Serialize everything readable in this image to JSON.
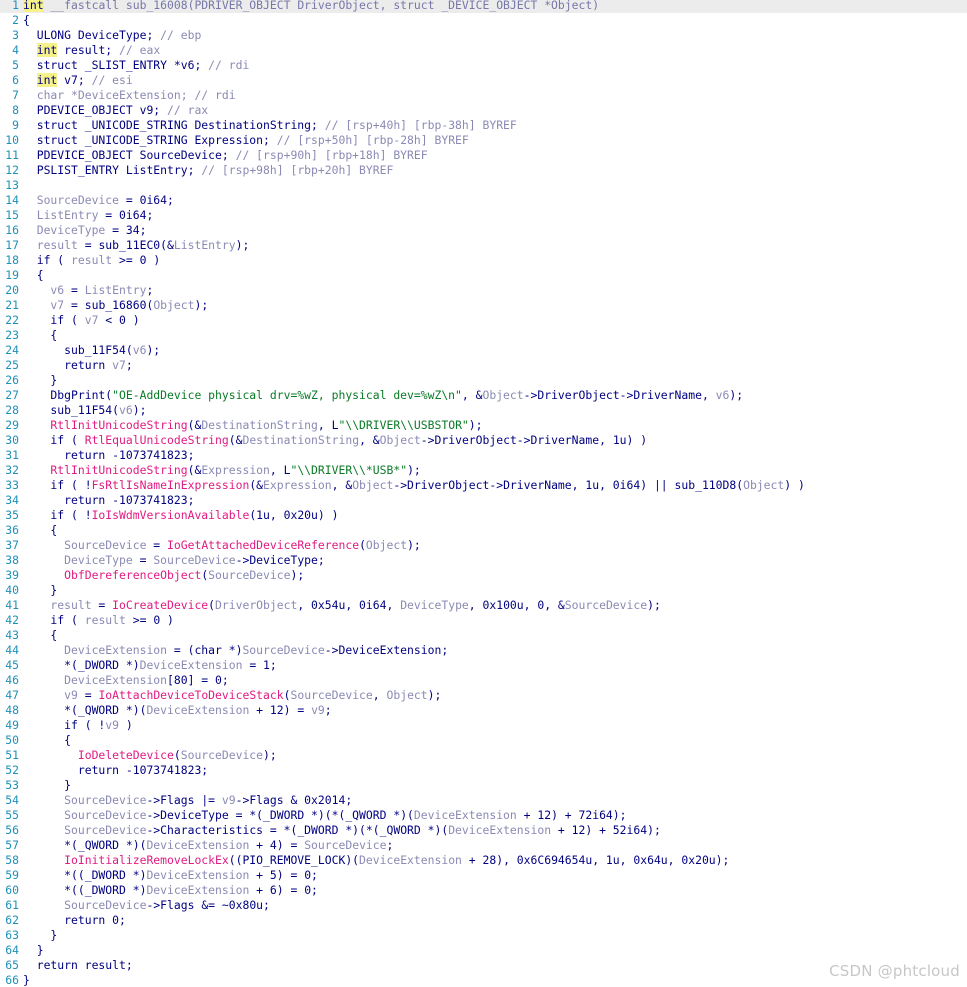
{
  "watermark": "CSDN @phtcloud",
  "colors": {
    "keyword": "#000080",
    "variable": "#8a8ab4",
    "function": "#e01b83",
    "string": "#0a7a26",
    "line_number": "#1e90b8",
    "highlight": "#f5f28a"
  },
  "lines": [
    {
      "n": "1",
      "t": [
        {
          "s": "hl",
          "v": "int"
        },
        {
          "s": "dim",
          "v": " __fastcall sub_16008(PDRIVER_OBJECT DriverObject, struct _DEVICE_OBJECT *Object)"
        }
      ]
    },
    {
      "n": "2",
      "t": [
        {
          "s": "txt",
          "v": "{"
        }
      ]
    },
    {
      "n": "3",
      "t": [
        {
          "s": "txt",
          "v": "  ULONG DeviceType; "
        },
        {
          "s": "cm",
          "v": "// ebp"
        }
      ]
    },
    {
      "n": "4",
      "t": [
        {
          "s": "txt",
          "v": "  "
        },
        {
          "s": "hl",
          "v": "int"
        },
        {
          "s": "txt",
          "v": " result; "
        },
        {
          "s": "cm",
          "v": "// eax"
        }
      ]
    },
    {
      "n": "5",
      "t": [
        {
          "s": "txt",
          "v": "  struct _SLIST_ENTRY *v6; "
        },
        {
          "s": "cm",
          "v": "// rdi"
        }
      ]
    },
    {
      "n": "6",
      "t": [
        {
          "s": "txt",
          "v": "  "
        },
        {
          "s": "hl",
          "v": "int"
        },
        {
          "s": "txt",
          "v": " v7; "
        },
        {
          "s": "cm",
          "v": "// esi"
        }
      ]
    },
    {
      "n": "7",
      "t": [
        {
          "s": "var",
          "v": "  char *DeviceExtension; "
        },
        {
          "s": "cm",
          "v": "// rdi"
        }
      ]
    },
    {
      "n": "8",
      "t": [
        {
          "s": "txt",
          "v": "  PDEVICE_OBJECT v9; "
        },
        {
          "s": "cm",
          "v": "// rax"
        }
      ]
    },
    {
      "n": "9",
      "t": [
        {
          "s": "txt",
          "v": "  struct _UNICODE_STRING DestinationString; "
        },
        {
          "s": "cm",
          "v": "// [rsp+40h] [rbp-38h] BYREF"
        }
      ]
    },
    {
      "n": "10",
      "t": [
        {
          "s": "txt",
          "v": "  struct _UNICODE_STRING Expression; "
        },
        {
          "s": "cm",
          "v": "// [rsp+50h] [rbp-28h] BYREF"
        }
      ]
    },
    {
      "n": "11",
      "t": [
        {
          "s": "txt",
          "v": "  PDEVICE_OBJECT SourceDevice; "
        },
        {
          "s": "cm",
          "v": "// [rsp+90h] [rbp+18h] BYREF"
        }
      ]
    },
    {
      "n": "12",
      "t": [
        {
          "s": "txt",
          "v": "  PSLIST_ENTRY ListEntry; "
        },
        {
          "s": "cm",
          "v": "// [rsp+98h] [rbp+20h] BYREF"
        }
      ]
    },
    {
      "n": "13",
      "t": []
    },
    {
      "n": "14",
      "t": [
        {
          "s": "var",
          "v": "  SourceDevice"
        },
        {
          "s": "txt",
          "v": " = 0i64;"
        }
      ]
    },
    {
      "n": "15",
      "t": [
        {
          "s": "var",
          "v": "  ListEntry"
        },
        {
          "s": "txt",
          "v": " = 0i64;"
        }
      ]
    },
    {
      "n": "16",
      "t": [
        {
          "s": "var",
          "v": "  DeviceType"
        },
        {
          "s": "txt",
          "v": " = 34;"
        }
      ]
    },
    {
      "n": "17",
      "t": [
        {
          "s": "var",
          "v": "  result"
        },
        {
          "s": "txt",
          "v": " = sub_11EC0(&"
        },
        {
          "s": "var",
          "v": "ListEntry"
        },
        {
          "s": "txt",
          "v": ");"
        }
      ]
    },
    {
      "n": "18",
      "t": [
        {
          "s": "txt",
          "v": "  if ( "
        },
        {
          "s": "var",
          "v": "result"
        },
        {
          "s": "txt",
          "v": " >= 0 )"
        }
      ]
    },
    {
      "n": "19",
      "t": [
        {
          "s": "txt",
          "v": "  {"
        }
      ]
    },
    {
      "n": "20",
      "t": [
        {
          "s": "var",
          "v": "    v6"
        },
        {
          "s": "txt",
          "v": " = "
        },
        {
          "s": "var",
          "v": "ListEntry"
        },
        {
          "s": "txt",
          "v": ";"
        }
      ]
    },
    {
      "n": "21",
      "t": [
        {
          "s": "var",
          "v": "    v7"
        },
        {
          "s": "txt",
          "v": " = sub_16860("
        },
        {
          "s": "var",
          "v": "Object"
        },
        {
          "s": "txt",
          "v": ");"
        }
      ]
    },
    {
      "n": "22",
      "t": [
        {
          "s": "txt",
          "v": "    if ( "
        },
        {
          "s": "var",
          "v": "v7"
        },
        {
          "s": "txt",
          "v": " < 0 )"
        }
      ]
    },
    {
      "n": "23",
      "t": [
        {
          "s": "txt",
          "v": "    {"
        }
      ]
    },
    {
      "n": "24",
      "t": [
        {
          "s": "txt",
          "v": "      sub_11F54("
        },
        {
          "s": "var",
          "v": "v6"
        },
        {
          "s": "txt",
          "v": ");"
        }
      ]
    },
    {
      "n": "25",
      "t": [
        {
          "s": "txt",
          "v": "      return "
        },
        {
          "s": "var",
          "v": "v7"
        },
        {
          "s": "txt",
          "v": ";"
        }
      ]
    },
    {
      "n": "26",
      "t": [
        {
          "s": "txt",
          "v": "    }"
        }
      ]
    },
    {
      "n": "27",
      "t": [
        {
          "s": "txt",
          "v": "    DbgPrint("
        },
        {
          "s": "str",
          "v": "\"OE-AddDevice physical drv=%wZ, physical dev=%wZ\\n\""
        },
        {
          "s": "txt",
          "v": ", &"
        },
        {
          "s": "var",
          "v": "Object"
        },
        {
          "s": "txt",
          "v": "->DriverObject->DriverName, "
        },
        {
          "s": "var",
          "v": "v6"
        },
        {
          "s": "txt",
          "v": ");"
        }
      ]
    },
    {
      "n": "28",
      "t": [
        {
          "s": "txt",
          "v": "    sub_11F54("
        },
        {
          "s": "var",
          "v": "v6"
        },
        {
          "s": "txt",
          "v": ");"
        }
      ]
    },
    {
      "n": "29",
      "t": [
        {
          "s": "fn",
          "v": "    RtlInitUnicodeString"
        },
        {
          "s": "txt",
          "v": "(&"
        },
        {
          "s": "var",
          "v": "DestinationString"
        },
        {
          "s": "txt",
          "v": ", L"
        },
        {
          "s": "str",
          "v": "\"\\\\DRIVER\\\\USBSTOR\""
        },
        {
          "s": "txt",
          "v": ");"
        }
      ]
    },
    {
      "n": "30",
      "t": [
        {
          "s": "txt",
          "v": "    if ( "
        },
        {
          "s": "fn",
          "v": "RtlEqualUnicodeString"
        },
        {
          "s": "txt",
          "v": "(&"
        },
        {
          "s": "var",
          "v": "DestinationString"
        },
        {
          "s": "txt",
          "v": ", &"
        },
        {
          "s": "var",
          "v": "Object"
        },
        {
          "s": "txt",
          "v": "->DriverObject->DriverName, 1u) )"
        }
      ]
    },
    {
      "n": "31",
      "t": [
        {
          "s": "txt",
          "v": "      return -1073741823;"
        }
      ]
    },
    {
      "n": "32",
      "t": [
        {
          "s": "fn",
          "v": "    RtlInitUnicodeString"
        },
        {
          "s": "txt",
          "v": "(&"
        },
        {
          "s": "var",
          "v": "Expression"
        },
        {
          "s": "txt",
          "v": ", L"
        },
        {
          "s": "str",
          "v": "\"\\\\DRIVER\\\\*USB*\""
        },
        {
          "s": "txt",
          "v": ");"
        }
      ]
    },
    {
      "n": "33",
      "t": [
        {
          "s": "txt",
          "v": "    if ( !"
        },
        {
          "s": "fn",
          "v": "FsRtlIsNameInExpression"
        },
        {
          "s": "txt",
          "v": "(&"
        },
        {
          "s": "var",
          "v": "Expression"
        },
        {
          "s": "txt",
          "v": ", &"
        },
        {
          "s": "var",
          "v": "Object"
        },
        {
          "s": "txt",
          "v": "->DriverObject->DriverName, 1u, 0i64) || sub_110D8("
        },
        {
          "s": "var",
          "v": "Object"
        },
        {
          "s": "txt",
          "v": ") )"
        }
      ]
    },
    {
      "n": "34",
      "t": [
        {
          "s": "txt",
          "v": "      return -1073741823;"
        }
      ]
    },
    {
      "n": "35",
      "t": [
        {
          "s": "txt",
          "v": "    if ( !"
        },
        {
          "s": "fn",
          "v": "IoIsWdmVersionAvailable"
        },
        {
          "s": "txt",
          "v": "(1u, 0x20u) )"
        }
      ]
    },
    {
      "n": "36",
      "t": [
        {
          "s": "txt",
          "v": "    {"
        }
      ]
    },
    {
      "n": "37",
      "t": [
        {
          "s": "var",
          "v": "      SourceDevice"
        },
        {
          "s": "txt",
          "v": " = "
        },
        {
          "s": "fn",
          "v": "IoGetAttachedDeviceReference"
        },
        {
          "s": "txt",
          "v": "("
        },
        {
          "s": "var",
          "v": "Object"
        },
        {
          "s": "txt",
          "v": ");"
        }
      ]
    },
    {
      "n": "38",
      "t": [
        {
          "s": "var",
          "v": "      DeviceType"
        },
        {
          "s": "txt",
          "v": " = "
        },
        {
          "s": "var",
          "v": "SourceDevice"
        },
        {
          "s": "txt",
          "v": "->DeviceType;"
        }
      ]
    },
    {
      "n": "39",
      "t": [
        {
          "s": "fn",
          "v": "      ObfDereferenceObject"
        },
        {
          "s": "txt",
          "v": "("
        },
        {
          "s": "var",
          "v": "SourceDevice"
        },
        {
          "s": "txt",
          "v": ");"
        }
      ]
    },
    {
      "n": "40",
      "t": [
        {
          "s": "txt",
          "v": "    }"
        }
      ]
    },
    {
      "n": "41",
      "t": [
        {
          "s": "var",
          "v": "    result"
        },
        {
          "s": "txt",
          "v": " = "
        },
        {
          "s": "fn",
          "v": "IoCreateDevice"
        },
        {
          "s": "txt",
          "v": "("
        },
        {
          "s": "var",
          "v": "DriverObject"
        },
        {
          "s": "txt",
          "v": ", 0x54u, 0i64, "
        },
        {
          "s": "var",
          "v": "DeviceType"
        },
        {
          "s": "txt",
          "v": ", 0x100u, 0, &"
        },
        {
          "s": "var",
          "v": "SourceDevice"
        },
        {
          "s": "txt",
          "v": ");"
        }
      ]
    },
    {
      "n": "42",
      "t": [
        {
          "s": "txt",
          "v": "    if ( "
        },
        {
          "s": "var",
          "v": "result"
        },
        {
          "s": "txt",
          "v": " >= 0 )"
        }
      ]
    },
    {
      "n": "43",
      "t": [
        {
          "s": "txt",
          "v": "    {"
        }
      ]
    },
    {
      "n": "44",
      "t": [
        {
          "s": "var",
          "v": "      DeviceExtension"
        },
        {
          "s": "txt",
          "v": " = (char *)"
        },
        {
          "s": "var",
          "v": "SourceDevice"
        },
        {
          "s": "txt",
          "v": "->DeviceExtension;"
        }
      ]
    },
    {
      "n": "45",
      "t": [
        {
          "s": "txt",
          "v": "      *(_DWORD *)"
        },
        {
          "s": "var",
          "v": "DeviceExtension"
        },
        {
          "s": "txt",
          "v": " = 1;"
        }
      ]
    },
    {
      "n": "46",
      "t": [
        {
          "s": "var",
          "v": "      DeviceExtension"
        },
        {
          "s": "txt",
          "v": "[80] = 0;"
        }
      ]
    },
    {
      "n": "47",
      "t": [
        {
          "s": "var",
          "v": "      v9"
        },
        {
          "s": "txt",
          "v": " = "
        },
        {
          "s": "fn",
          "v": "IoAttachDeviceToDeviceStack"
        },
        {
          "s": "txt",
          "v": "("
        },
        {
          "s": "var",
          "v": "SourceDevice"
        },
        {
          "s": "txt",
          "v": ", "
        },
        {
          "s": "var",
          "v": "Object"
        },
        {
          "s": "txt",
          "v": ");"
        }
      ]
    },
    {
      "n": "48",
      "t": [
        {
          "s": "txt",
          "v": "      *(_QWORD *)("
        },
        {
          "s": "var",
          "v": "DeviceExtension"
        },
        {
          "s": "txt",
          "v": " + 12) = "
        },
        {
          "s": "var",
          "v": "v9"
        },
        {
          "s": "txt",
          "v": ";"
        }
      ]
    },
    {
      "n": "49",
      "t": [
        {
          "s": "txt",
          "v": "      if ( !"
        },
        {
          "s": "var",
          "v": "v9"
        },
        {
          "s": "txt",
          "v": " )"
        }
      ]
    },
    {
      "n": "50",
      "t": [
        {
          "s": "txt",
          "v": "      {"
        }
      ]
    },
    {
      "n": "51",
      "t": [
        {
          "s": "fn",
          "v": "        IoDeleteDevice"
        },
        {
          "s": "txt",
          "v": "("
        },
        {
          "s": "var",
          "v": "SourceDevice"
        },
        {
          "s": "txt",
          "v": ");"
        }
      ]
    },
    {
      "n": "52",
      "t": [
        {
          "s": "txt",
          "v": "        return -1073741823;"
        }
      ]
    },
    {
      "n": "53",
      "t": [
        {
          "s": "txt",
          "v": "      }"
        }
      ]
    },
    {
      "n": "54",
      "t": [
        {
          "s": "var",
          "v": "      SourceDevice"
        },
        {
          "s": "txt",
          "v": "->Flags |= "
        },
        {
          "s": "var",
          "v": "v9"
        },
        {
          "s": "txt",
          "v": "->Flags & 0x2014;"
        }
      ]
    },
    {
      "n": "55",
      "t": [
        {
          "s": "var",
          "v": "      SourceDevice"
        },
        {
          "s": "txt",
          "v": "->DeviceType = *(_DWORD *)(*(_QWORD *)("
        },
        {
          "s": "var",
          "v": "DeviceExtension"
        },
        {
          "s": "txt",
          "v": " + 12) + 72i64);"
        }
      ]
    },
    {
      "n": "56",
      "t": [
        {
          "s": "var",
          "v": "      SourceDevice"
        },
        {
          "s": "txt",
          "v": "->Characteristics = *(_DWORD *)(*(_QWORD *)("
        },
        {
          "s": "var",
          "v": "DeviceExtension"
        },
        {
          "s": "txt",
          "v": " + 12) + 52i64);"
        }
      ]
    },
    {
      "n": "57",
      "t": [
        {
          "s": "txt",
          "v": "      *(_QWORD *)("
        },
        {
          "s": "var",
          "v": "DeviceExtension"
        },
        {
          "s": "txt",
          "v": " + 4) = "
        },
        {
          "s": "var",
          "v": "SourceDevice"
        },
        {
          "s": "txt",
          "v": ";"
        }
      ]
    },
    {
      "n": "58",
      "t": [
        {
          "s": "fn",
          "v": "      IoInitializeRemoveLockEx"
        },
        {
          "s": "txt",
          "v": "((PIO_REMOVE_LOCK)("
        },
        {
          "s": "var",
          "v": "DeviceExtension"
        },
        {
          "s": "txt",
          "v": " + 28), 0x6C694654u, 1u, 0x64u, 0x20u);"
        }
      ]
    },
    {
      "n": "59",
      "t": [
        {
          "s": "txt",
          "v": "      *((_DWORD *)"
        },
        {
          "s": "var",
          "v": "DeviceExtension"
        },
        {
          "s": "txt",
          "v": " + 5) = 0;"
        }
      ]
    },
    {
      "n": "60",
      "t": [
        {
          "s": "txt",
          "v": "      *((_DWORD *)"
        },
        {
          "s": "var",
          "v": "DeviceExtension"
        },
        {
          "s": "txt",
          "v": " + 6) = 0;"
        }
      ]
    },
    {
      "n": "61",
      "t": [
        {
          "s": "var",
          "v": "      SourceDevice"
        },
        {
          "s": "txt",
          "v": "->Flags &= ~0x80u;"
        }
      ]
    },
    {
      "n": "62",
      "t": [
        {
          "s": "txt",
          "v": "      return 0;"
        }
      ]
    },
    {
      "n": "63",
      "t": [
        {
          "s": "txt",
          "v": "    }"
        }
      ]
    },
    {
      "n": "64",
      "t": [
        {
          "s": "txt",
          "v": "  }"
        }
      ]
    },
    {
      "n": "65",
      "t": [
        {
          "s": "txt",
          "v": "  return result;"
        }
      ]
    },
    {
      "n": "66",
      "t": [
        {
          "s": "txt",
          "v": "}"
        }
      ]
    }
  ]
}
